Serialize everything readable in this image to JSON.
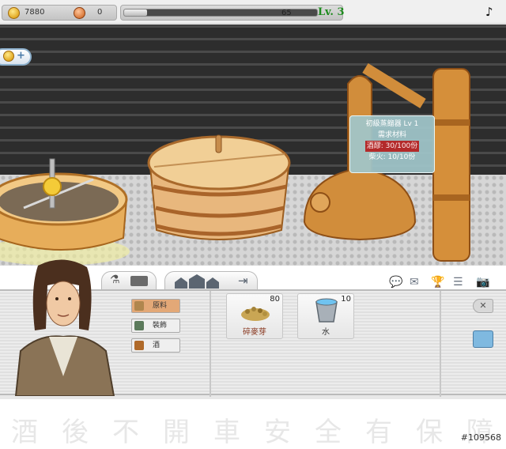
{
  "hud": {
    "gold": "7880",
    "copper": "0",
    "xp_value": "65",
    "xp_fraction": 0.12,
    "level": "Lv. 3",
    "music_icon": "music-note-icon"
  },
  "tooltip": {
    "title": "初級蒸餾器 Lv 1",
    "subtitle": "需求材料",
    "req1": "酒醪: 30/100份",
    "req2": "柴火: 10/10份"
  },
  "categories": [
    {
      "label": "原料",
      "icon": "sack-icon",
      "active": true
    },
    {
      "label": "裝飾",
      "icon": "decoration-icon",
      "active": false
    },
    {
      "label": "酒",
      "icon": "barrel-icon",
      "active": false
    }
  ],
  "items": [
    {
      "name": "碎麥芽",
      "qty": "80",
      "icon": "malt-icon"
    },
    {
      "name": "水",
      "qty": "10",
      "icon": "water-bucket-icon"
    }
  ],
  "toolbar_icons": [
    "chat-icon",
    "mail-icon",
    "trophy-icon",
    "list-icon",
    "camera-icon"
  ],
  "slogan": [
    "酒",
    "後",
    "不",
    "開",
    "車",
    "安",
    "全",
    "有",
    "保",
    "障"
  ],
  "watermark": "#109568",
  "colors": {
    "level_green": "#1d8a1d",
    "tooltip_bg": "#a0c6ca",
    "copper": "#c98a3a"
  }
}
